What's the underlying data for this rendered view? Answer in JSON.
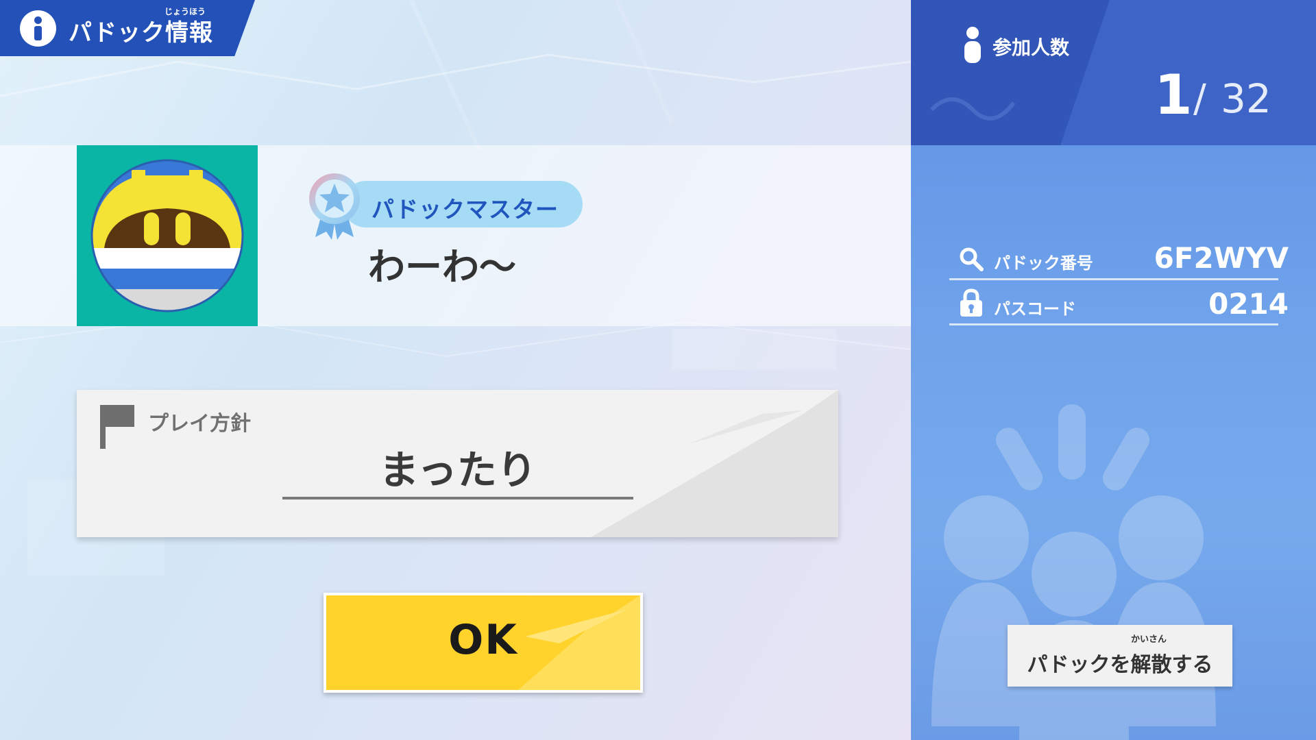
{
  "header": {
    "title": "パドック情報",
    "ruby": "じょうほう",
    "icon": "info-icon",
    "color": "#2451b8"
  },
  "profile": {
    "avatar_icon": "magolor-ship-avatar",
    "avatar_bg_color": "#0ab5a5",
    "rank_badge_icon": "star-medal-icon",
    "rank_title": "パドックマスター",
    "player_name": "わーわ〜"
  },
  "play_policy": {
    "icon": "flag-icon",
    "label": "プレイ方針",
    "value": "まったり"
  },
  "ok_button": {
    "label": "OK",
    "color": "#ffd22c"
  },
  "participants": {
    "icon": "person-icon",
    "label": "参加人数",
    "current": "1",
    "separator": "/",
    "max": "32"
  },
  "paddock_number": {
    "icon": "search-icon",
    "label": "パドック番号",
    "value": "6F2WYV"
  },
  "passcode": {
    "icon": "lock-icon",
    "label": "パスコード",
    "value": "0214"
  },
  "disband_button": {
    "label": "パドックを解散する",
    "ruby": "かいさん"
  },
  "colors": {
    "panel_blue": "#3d64c6",
    "panel_light_blue": "#6ea1ea",
    "rank_pill": "#a6dbf5",
    "rank_text": "#1f55bd"
  }
}
